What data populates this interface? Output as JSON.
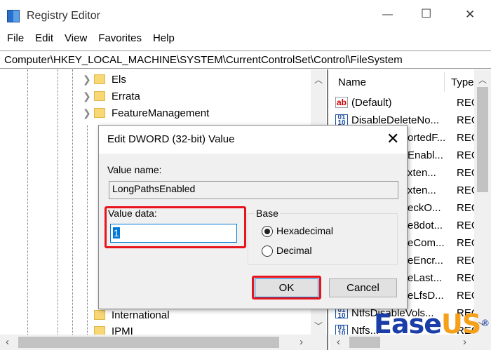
{
  "window": {
    "title": "Registry Editor",
    "minimize": "—",
    "maximize": "☐",
    "close": "✕"
  },
  "menu": [
    "File",
    "Edit",
    "View",
    "Favorites",
    "Help"
  ],
  "address": "Computer\\HKEY_LOCAL_MACHINE\\SYSTEM\\CurrentControlSet\\Control\\FileSystem",
  "tree": [
    {
      "label": "Els",
      "expandable": true
    },
    {
      "label": "Errata",
      "expandable": true
    },
    {
      "label": "FeatureManagement",
      "expandable": true
    },
    {
      "label": "International",
      "expandable": false
    },
    {
      "label": "IPMI",
      "expandable": false
    }
  ],
  "list": {
    "headers": {
      "name": "Name",
      "type": "Type"
    },
    "rows": [
      {
        "name": "(Default)",
        "type": "REG_",
        "icon": "ab"
      },
      {
        "name": "DisableDeleteNo...",
        "type": "REG_",
        "icon": "bin"
      },
      {
        "name": "ortedF...",
        "type": "REG_",
        "icon": "bin"
      },
      {
        "name": "Enabl...",
        "type": "REG_",
        "icon": "bin"
      },
      {
        "name": "xten...",
        "type": "REG_",
        "icon": "bin"
      },
      {
        "name": "xten...",
        "type": "REG_",
        "icon": "bin"
      },
      {
        "name": "eckO...",
        "type": "REG_",
        "icon": "bin"
      },
      {
        "name": "e8dot...",
        "type": "REG_",
        "icon": "bin"
      },
      {
        "name": "eCom...",
        "type": "REG_",
        "icon": "bin"
      },
      {
        "name": "eEncr...",
        "type": "REG_",
        "icon": "bin"
      },
      {
        "name": "eLast...",
        "type": "REG_",
        "icon": "bin"
      },
      {
        "name": "eLfsD...",
        "type": "REG_",
        "icon": "bin"
      },
      {
        "name": "NtfsDisableVols...",
        "type": "REG_",
        "icon": "bin"
      },
      {
        "name": "Ntfs...",
        "type": "REG_",
        "icon": "bin"
      }
    ]
  },
  "dialog": {
    "title": "Edit DWORD (32-bit) Value",
    "value_name_label": "Value name:",
    "value_name": "LongPathsEnabled",
    "value_data_label": "Value data:",
    "value_data": "1",
    "base_label": "Base",
    "hex_label": "Hexadecimal",
    "dec_label": "Decimal",
    "base_selected": "Hexadecimal",
    "ok": "OK",
    "cancel": "Cancel"
  },
  "watermark": {
    "text_a": "Ease",
    "text_b": "US",
    "reg": "®"
  },
  "colors": {
    "highlight": "#e8141c",
    "logo_blue": "#1a3da8",
    "logo_orange": "#f5a01a"
  }
}
